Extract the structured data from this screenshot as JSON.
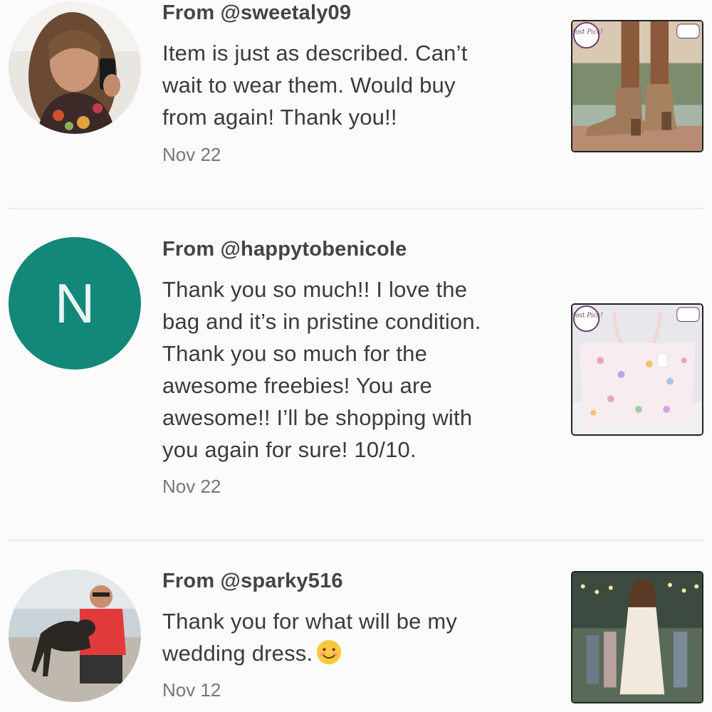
{
  "reviews": [
    {
      "from": "From @sweetaly09",
      "lines": [
        "Item is just as described. Can’t",
        "wait to wear them. Would buy",
        "from again! Thank you!!"
      ],
      "date": "Nov 22",
      "avatar_icon": "woman-selfie-photo",
      "thumbnail_icon": "ankle-boots-photo",
      "badge_text": "Host Pick!"
    },
    {
      "from": "From @happytobenicole",
      "lines": [
        "Thank you so much!! I love the",
        "bag and it’s in pristine condition.",
        "Thank you so much for the",
        "awesome freebies! You are",
        "awesome!! I’ll be shopping with",
        "you again for sure! 10/10."
      ],
      "date": "Nov 22",
      "avatar_letter": "N",
      "avatar_color": "#138778",
      "thumbnail_icon": "floral-tote-bag-photo",
      "badge_text": "Host Pick!"
    },
    {
      "from": "From @sparky516",
      "lines": [
        "Thank you for what will be my",
        "wedding dress."
      ],
      "emoji": "smiling-face-emoji",
      "date": "Nov 12",
      "avatar_icon": "man-with-dog-photo",
      "thumbnail_icon": "white-dress-photo"
    }
  ]
}
